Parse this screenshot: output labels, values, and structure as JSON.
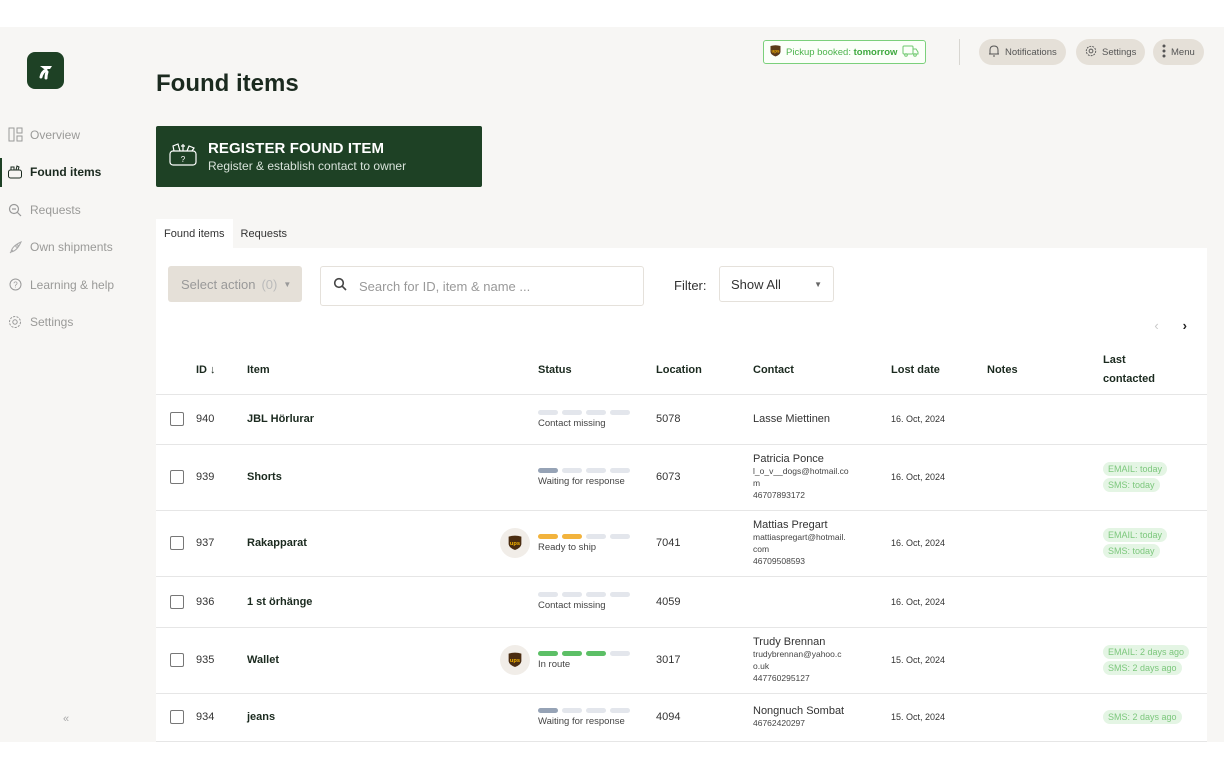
{
  "sidebar": {
    "logo": "logo-icon",
    "items": [
      {
        "label": "Overview",
        "icon": "layout-icon",
        "active": false
      },
      {
        "label": "Found items",
        "icon": "basket-icon",
        "active": true
      },
      {
        "label": "Requests",
        "icon": "search-icon",
        "active": false
      },
      {
        "label": "Own shipments",
        "icon": "rocket-icon",
        "active": false
      },
      {
        "label": "Learning & help",
        "icon": "help-icon",
        "active": false
      },
      {
        "label": "Settings",
        "icon": "gear-icon",
        "active": false
      }
    ],
    "collapse_label": "«"
  },
  "topbar": {
    "pickup_prefix": "Pickup booked: ",
    "pickup_value": "tomorrow",
    "notifications_label": "Notifications",
    "settings_label": "Settings",
    "menu_label": "Menu"
  },
  "page": {
    "title": "Found items",
    "register_title": "REGISTER FOUND ITEM",
    "register_subtitle": "Register & establish contact to owner"
  },
  "tabs": [
    {
      "label": "Found items",
      "active": true
    },
    {
      "label": "Requests",
      "active": false
    }
  ],
  "toolbar": {
    "select_action_label": "Select action",
    "select_action_count": "(0)",
    "search_placeholder": "Search for ID, item & name ...",
    "filter_label": "Filter:",
    "filter_value": "Show All",
    "prev_label": "‹",
    "next_label": "›"
  },
  "table": {
    "columns": [
      "ID ↓",
      "Item",
      "Status",
      "Location",
      "Contact",
      "Lost date",
      "Notes",
      "Last contacted"
    ],
    "status_colors": {
      "empty": "#e3e6ec",
      "waiting": "#96a3b6",
      "ready": "#f2b33d",
      "route": "#5cbf66"
    },
    "rows": [
      {
        "id": "940",
        "item": "JBL Hörlurar",
        "carrier": "",
        "status": "Contact missing",
        "progress": {
          "filled": 0,
          "total": 4,
          "color": "empty"
        },
        "location": "5078",
        "contact_name": "Lasse Miettinen",
        "contact_lines": [],
        "lost_date": "16. Oct, 2024",
        "notes": "",
        "last_contacted": []
      },
      {
        "id": "939",
        "item": "Shorts",
        "carrier": "",
        "status": "Waiting for response",
        "progress": {
          "filled": 1,
          "total": 4,
          "color": "waiting"
        },
        "location": "6073",
        "contact_name": "Patricia Ponce",
        "contact_lines": [
          "l_o_v__dogs@hotmail.co",
          "m",
          "46707893172"
        ],
        "lost_date": "16. Oct, 2024",
        "notes": "",
        "last_contacted": [
          "EMAIL: today",
          "SMS: today"
        ]
      },
      {
        "id": "937",
        "item": "Rakapparat",
        "carrier": "ups",
        "status": "Ready to ship",
        "progress": {
          "filled": 2,
          "total": 4,
          "color": "ready"
        },
        "location": "7041",
        "contact_name": "Mattias Pregart",
        "contact_lines": [
          "mattiaspregart@hotmail.",
          "com",
          "46709508593"
        ],
        "lost_date": "16. Oct, 2024",
        "notes": "",
        "last_contacted": [
          "EMAIL: today",
          "SMS: today"
        ]
      },
      {
        "id": "936",
        "item": "1 st örhänge",
        "carrier": "",
        "status": "Contact missing",
        "progress": {
          "filled": 0,
          "total": 4,
          "color": "empty"
        },
        "location": "4059",
        "contact_name": "",
        "contact_lines": [],
        "lost_date": "16. Oct, 2024",
        "notes": "",
        "last_contacted": []
      },
      {
        "id": "935",
        "item": "Wallet",
        "carrier": "ups",
        "status": "In route",
        "progress": {
          "filled": 3,
          "total": 4,
          "color": "route"
        },
        "location": "3017",
        "contact_name": "Trudy Brennan",
        "contact_lines": [
          "trudybrennan@yahoo.c",
          "o.uk",
          "447760295127"
        ],
        "lost_date": "15. Oct, 2024",
        "notes": "",
        "last_contacted": [
          "EMAIL: 2 days ago",
          "SMS: 2 days ago"
        ]
      },
      {
        "id": "934",
        "item": "jeans",
        "carrier": "",
        "status": "Waiting for response",
        "progress": {
          "filled": 1,
          "total": 4,
          "color": "waiting"
        },
        "location": "4094",
        "contact_name": "Nongnuch Sombat",
        "contact_lines": [
          "46762420297"
        ],
        "lost_date": "15. Oct, 2024",
        "notes": "",
        "last_contacted": [
          "SMS: 2 days ago"
        ]
      }
    ]
  }
}
